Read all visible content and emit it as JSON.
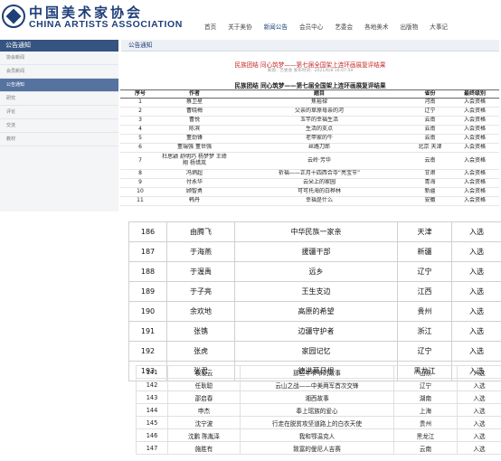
{
  "site": {
    "logo_cn": "中国美术家协会",
    "logo_en": "CHINA ARTISTS ASSOCIATION",
    "nav": [
      "首页",
      "关于美协",
      "新闻公告",
      "会员中心",
      "艺委会",
      "各地美术",
      "出版物",
      "大事记"
    ]
  },
  "sidebar": {
    "title": "公告通知",
    "items": [
      "协会新闻",
      "会员新闻",
      "公告通知",
      "研究",
      "评论",
      "交流",
      "教材"
    ]
  },
  "main": {
    "header": "公告通知",
    "article_title": "民族团结 同心筑梦——第七届全国架上连环画展复评结果",
    "article_meta": "来源：艺委会 发布时间：2021/6/8 16:07:59",
    "table_caption": "民族团结 同心筑梦——第七届全国架上连环画展复评结果",
    "columns": [
      "序号",
      "作者",
      "题目",
      "省份",
      "最终级别"
    ],
    "rows": [
      [
        "1",
        "蔡卫星",
        "焦裕禄",
        "河南",
        "入会资格"
      ],
      [
        "2",
        "曹晓梅",
        "父亲的草原母亲的河",
        "辽宁",
        "入会资格"
      ],
      [
        "3",
        "曹悦",
        "玉竿的幸福生活",
        "云南",
        "入会资格"
      ],
      [
        "4",
        "陈滨",
        "生活的支点",
        "云南",
        "入会资格"
      ],
      [
        "5",
        "董劲锋",
        "老甲家的牛",
        "云南",
        "入会资格"
      ],
      [
        "6",
        "董瑞强 董世强",
        "丝路刀郎",
        "北京 天津",
        "入会资格"
      ],
      [
        "7",
        "杜思颖 舒明巧 杨梦梦 王绛翔 杨惜岚",
        "云岭·芳华",
        "云南",
        "入会资格"
      ],
      [
        "8",
        "冯炳超",
        "祈福——正月十四西合寺“亮宝节”",
        "甘肃",
        "入会资格"
      ],
      [
        "9",
        "付永华",
        "云朵上的家园",
        "青海",
        "入会资格"
      ],
      [
        "10",
        "顾智勇",
        "可可托海的白桦林",
        "新疆",
        "入会资格"
      ],
      [
        "11",
        "韩丹",
        "幸福是什么",
        "安徽",
        "入会资格"
      ]
    ]
  },
  "table_mid": {
    "rows": [
      [
        "186",
        "由腾飞",
        "中华民族一家亲",
        "天津",
        "入选"
      ],
      [
        "187",
        "于海燕",
        "援疆干部",
        "新疆",
        "入选"
      ],
      [
        "188",
        "于渥禹",
        "远乡",
        "辽宁",
        "入选"
      ],
      [
        "189",
        "于子亮",
        "王生支边",
        "江西",
        "入选"
      ],
      [
        "190",
        "余欢地",
        "高原的希望",
        "贵州",
        "入选"
      ],
      [
        "191",
        "张镌",
        "边疆守护者",
        "浙江",
        "入选"
      ],
      [
        "192",
        "张虎",
        "家园记忆",
        "辽宁",
        "入选"
      ],
      [
        "193",
        "张君",
        "德洪莫日根",
        "黑龙江",
        "入选"
      ]
    ]
  },
  "table_bottom": {
    "rows": [
      [
        "141",
        "权凌云",
        "那些年爷爷的故事",
        "山东",
        "入选"
      ],
      [
        "142",
        "任耿聪",
        "云山之战——中美两军首次交锋",
        "辽宁",
        "入选"
      ],
      [
        "143",
        "邵启春",
        "湘西故事",
        "湖南",
        "入选"
      ],
      [
        "144",
        "申杰",
        "奉上瑶族的爱心",
        "上海",
        "入选"
      ],
      [
        "145",
        "沈宁波",
        "行走在脱贫攻坚道路上的白衣天使",
        "贵州",
        "入选"
      ],
      [
        "146",
        "沈鹏 陈胤泽",
        "我和鄂温克人",
        "黑龙江",
        "入选"
      ],
      [
        "147",
        "施胜有",
        "致富的僾尼人吉赛",
        "云南",
        "入选"
      ]
    ]
  }
}
